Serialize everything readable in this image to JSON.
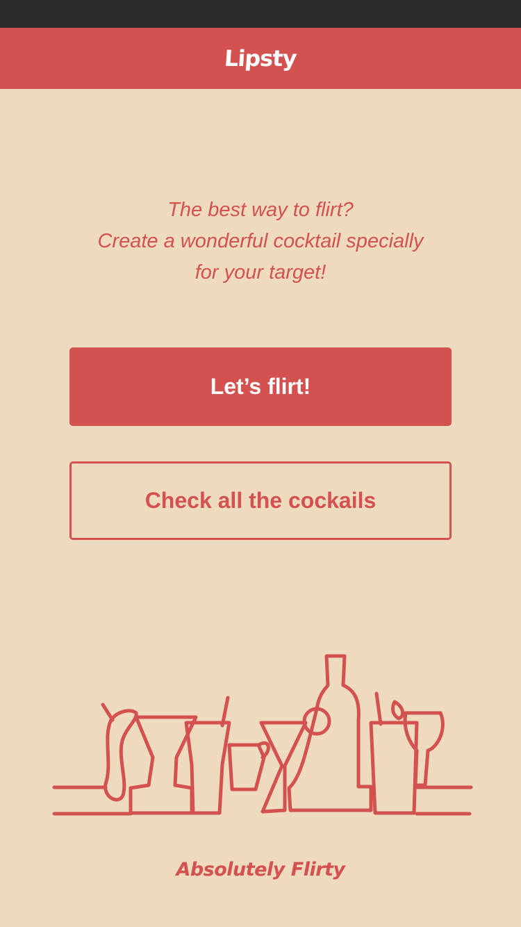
{
  "app": {
    "title": "Lipsty"
  },
  "intro": {
    "lines": [
      "The best way to flirt?",
      "Create a wonderful cocktail specially",
      "for your target!"
    ]
  },
  "actions": {
    "primary_label": "Let’s flirt!",
    "secondary_label": "Check all the cockails"
  },
  "footer": {
    "slogan": "Absolutely Flirty"
  },
  "illustration": {
    "icon": "cocktail-bar-line-art"
  },
  "colors": {
    "accent": "#D35250",
    "background": "#EEDABE",
    "status_bar": "#2B2B2B",
    "on_accent": "#FFFFFF"
  }
}
